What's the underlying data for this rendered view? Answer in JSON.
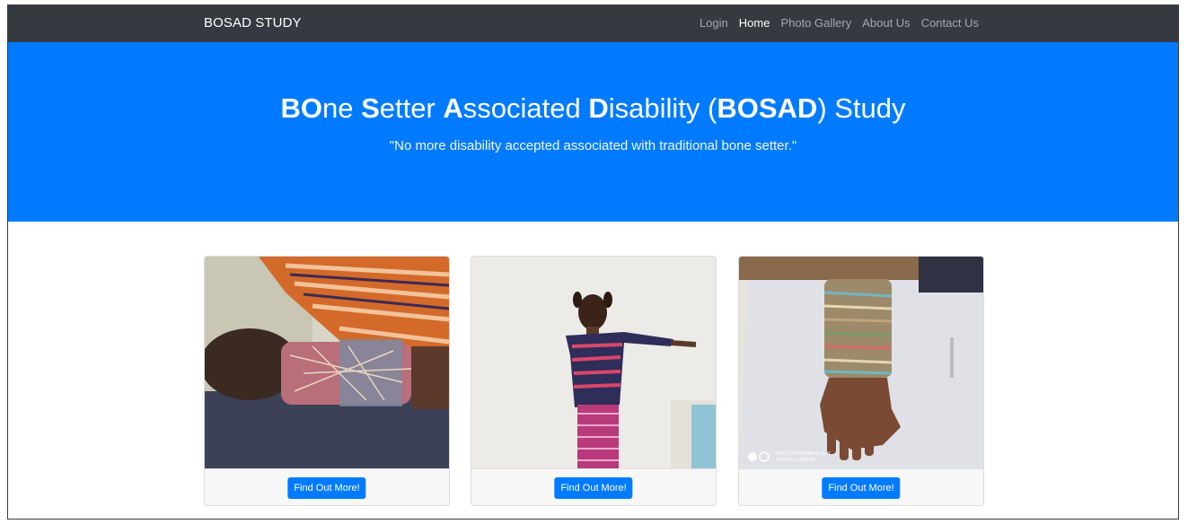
{
  "navbar": {
    "brand": "BOSAD STUDY",
    "links": [
      {
        "label": "Login",
        "active": false
      },
      {
        "label": "Home",
        "active": true
      },
      {
        "label": "Photo Gallery",
        "active": false
      },
      {
        "label": "About Us",
        "active": false
      },
      {
        "label": "Contact Us",
        "active": false
      }
    ]
  },
  "hero": {
    "title_parts": [
      {
        "text": "BO",
        "bold": true
      },
      {
        "text": "ne ",
        "bold": false
      },
      {
        "text": "S",
        "bold": true
      },
      {
        "text": "etter ",
        "bold": false
      },
      {
        "text": "A",
        "bold": true
      },
      {
        "text": "ssociated ",
        "bold": false
      },
      {
        "text": "D",
        "bold": true
      },
      {
        "text": "isability (",
        "bold": false
      },
      {
        "text": "BOSAD",
        "bold": true
      },
      {
        "text": ") Study",
        "bold": false
      }
    ],
    "subtitle": "\"No more disability accepted associated with traditional bone setter.\""
  },
  "cards": [
    {
      "button_label": "Find Out More!"
    },
    {
      "button_label": "Find Out More!"
    },
    {
      "button_label": "Find Out More!",
      "watermark_line1": "SHOT ON REDMI NOTE 7",
      "watermark_line2": "MI DUAL CAMERA"
    }
  ],
  "colors": {
    "navbar": "#343a40",
    "hero": "#007bff",
    "button": "#007bff"
  }
}
